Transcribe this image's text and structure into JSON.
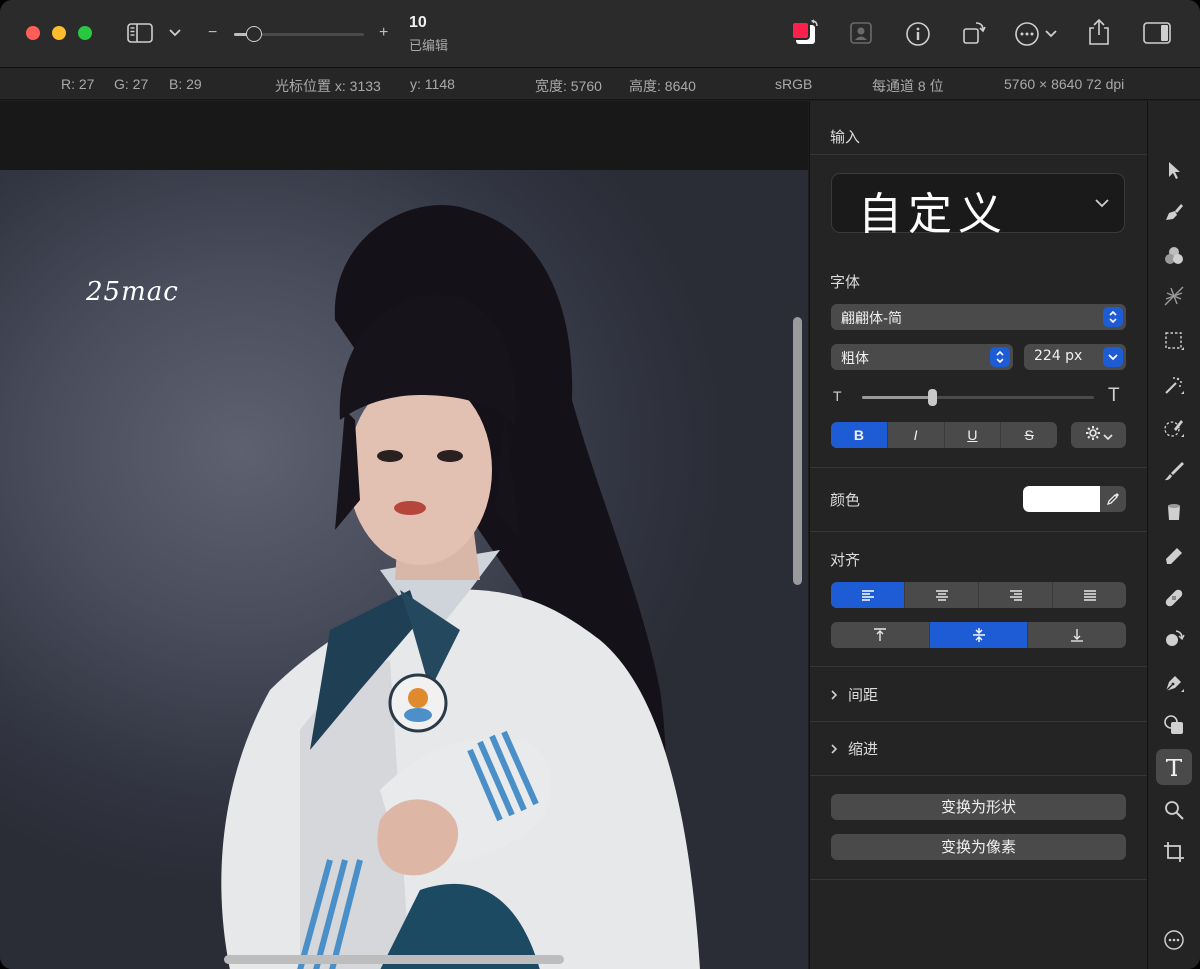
{
  "titlebar": {
    "doc_title": "10",
    "doc_subtitle": "已编辑",
    "zoom_minus": "−",
    "zoom_plus": "+",
    "zoom_level": 0.15
  },
  "infobar": {
    "r": "R: 27",
    "g": "G: 27",
    "b": "B: 29",
    "cursor_x": "光标位置 x: 3133",
    "cursor_y": "y: 1148",
    "width": "宽度: 5760",
    "height": "高度: 8640",
    "colorspace": "sRGB",
    "bits": "每通道 8 位",
    "dimensions": "5760 × 8640 72 dpi"
  },
  "canvas": {
    "watermark": "25mac"
  },
  "panel": {
    "header": "输入",
    "preset": "自定义",
    "font_section": "字体",
    "font_family": "翩翩体-简",
    "font_style": "粗体",
    "font_size": "224 px",
    "size_slider": 0.3,
    "style_buttons": {
      "bold": "B",
      "italic": "I",
      "underline": "U",
      "strike": "S"
    },
    "color_label": "颜色",
    "text_color": "#ffffff",
    "align_label": "对齐",
    "spacing_label": "间距",
    "indent_label": "缩进",
    "convert_shape": "变换为形状",
    "convert_pixels": "变换为像素"
  },
  "colors": {
    "accent": "#1e5cd6",
    "close": "#ff5f57",
    "minimize": "#febc2e",
    "maximize": "#28c840",
    "swatch_fg": "#ff1f4b"
  }
}
